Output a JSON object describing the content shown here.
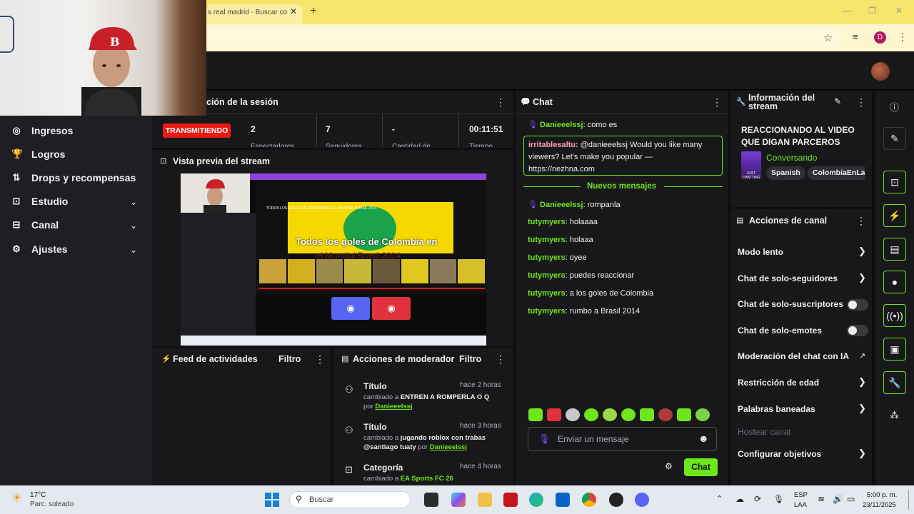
{
  "browser": {
    "tab_title": "s real madrid - Buscar co",
    "new_tab_icon": "plus-icon",
    "profile_initial": "D"
  },
  "webcam": {
    "description_hidden": true
  },
  "nav": {
    "items": [
      {
        "label": "Ingresos",
        "icon": "coin-icon",
        "chevron": false
      },
      {
        "label": "Logros",
        "icon": "trophy-icon",
        "chevron": false
      },
      {
        "label": "Drops y recompensas",
        "icon": "gift-icon",
        "chevron": false
      },
      {
        "label": "Estudio",
        "icon": "camera-icon",
        "chevron": true
      },
      {
        "label": "Canal",
        "icon": "channel-icon",
        "chevron": true
      },
      {
        "label": "Ajustes",
        "icon": "gear-icon",
        "chevron": true
      }
    ]
  },
  "session": {
    "title": "ción de la sesión",
    "live_badge": "TRANSMITIENDO",
    "viewers": "2",
    "viewers_label": "Espectadores",
    "followers": "7",
    "followers_label": "Seguidores",
    "subs": "-",
    "subs_label": "Cantidad de",
    "time": "00:11:51",
    "time_label": "Tiempo"
  },
  "preview": {
    "title": "Vista previa del stream",
    "video_headline": "TODOS LOS GOLES DE COLOMBIA EN EL MUNDIAL BRASIL 2014",
    "video_caption": "Todos los goles de Colombia en",
    "video_caption2": "el Mundial Brasil 2014"
  },
  "feed": {
    "title": "Feed de actividades",
    "filter": "Filtro"
  },
  "mod": {
    "title": "Acciones de moderador",
    "filter": "Filtro",
    "entries": [
      {
        "kind": "Título",
        "time": "hace 2 horas",
        "text": "cambiado a ",
        "value": "ENTREN A ROMPERLA O Q",
        "by": "por ",
        "user": "Danieeelssj"
      },
      {
        "kind": "Título",
        "time": "hace 3 horas",
        "text": "cambiado a ",
        "value": "jugando roblox con trabas @santiago tuaty",
        "by": " por ",
        "user": "Danieeelssj"
      },
      {
        "kind": "Categoría",
        "time": "hace 4 horas",
        "text": "cambiado a ",
        "value": "EA Sports FC 26",
        "by": " por ",
        "user": ""
      }
    ]
  },
  "chat": {
    "title": "Chat",
    "first": {
      "user": "Danieeelssj",
      "text": "como es"
    },
    "promo": {
      "user": "irritablesaltu:",
      "text": "@danieeelssj Would you like many viewers? Let's make you popular — https://nezhna.com"
    },
    "new_messages": "Nuevos mensajes",
    "messages": [
      {
        "user": "Danieeelssj",
        "text": "rompanla",
        "mic": true
      },
      {
        "user": "tutymyers",
        "text": "holaaaa",
        "mic": false
      },
      {
        "user": "tutymyers",
        "text": "holaaa",
        "mic": false
      },
      {
        "user": "tutymyers",
        "text": "oyee",
        "mic": false
      },
      {
        "user": "tutymyers",
        "text": "puedes reaccionar",
        "mic": false
      },
      {
        "user": "tutymyers",
        "text": "a los goles de Colombia",
        "mic": false
      },
      {
        "user": "tutymyers",
        "text": "rumbo a Brasil 2014",
        "mic": false
      }
    ],
    "input_placeholder": "Enviar un mensaje",
    "send_label": "Chat"
  },
  "stream_info": {
    "title": "Información del stream",
    "stream_title": "REACCIONANDO AL VIDEO QUE DIGAN PARCEROS",
    "category": "Conversando",
    "tags": [
      "Spanish",
      "ColombiaEnLaC"
    ],
    "box_art_text": "JUST CHATTING"
  },
  "channel_actions": {
    "title": "Acciones de canal",
    "items": [
      {
        "label": "Modo lento",
        "control": "chevron"
      },
      {
        "label": "Chat de solo-seguidores",
        "control": "chevron"
      },
      {
        "label": "Chat de solo-suscriptores",
        "control": "toggle"
      },
      {
        "label": "Chat de solo-emotes",
        "control": "toggle"
      },
      {
        "label": "Moderación del chat con IA",
        "control": "external"
      },
      {
        "label": "Restricción de edad",
        "control": "chevron"
      },
      {
        "label": "Palabras baneadas",
        "control": "chevron"
      },
      {
        "label": "Hostear canal",
        "control": "disabled"
      },
      {
        "label": "Configurar objetivos",
        "control": "chevron"
      }
    ]
  },
  "taskbar": {
    "weather_temp": "17°C",
    "weather_desc": "Parc. soleado",
    "search_label": "Buscar",
    "lang_top": "ESP",
    "lang_bottom": "LAA",
    "time": "5:00 p. m.",
    "date": "23/11/2025"
  },
  "colors": {
    "accent": "#6de61c",
    "live": "#e91916",
    "panel": "#18181b",
    "chrome": "#f7e46a"
  }
}
